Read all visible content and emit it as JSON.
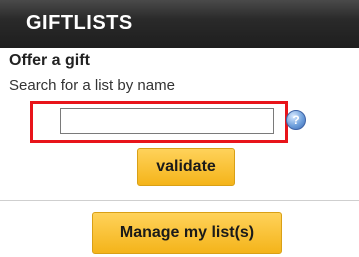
{
  "header": {
    "title": "GIFTLISTS"
  },
  "offer": {
    "heading": "Offer a gift",
    "instructions": "Search for a list by name"
  },
  "search": {
    "value": "",
    "placeholder": ""
  },
  "help": {
    "icon": "help-question-icon",
    "glyph": "?"
  },
  "buttons": {
    "validate_label": "validate",
    "manage_label": "Manage my list(s)"
  },
  "colors": {
    "header_bg": "#1e1e1e",
    "button_bg": "#f4b41a",
    "highlight": "#e8141a"
  }
}
